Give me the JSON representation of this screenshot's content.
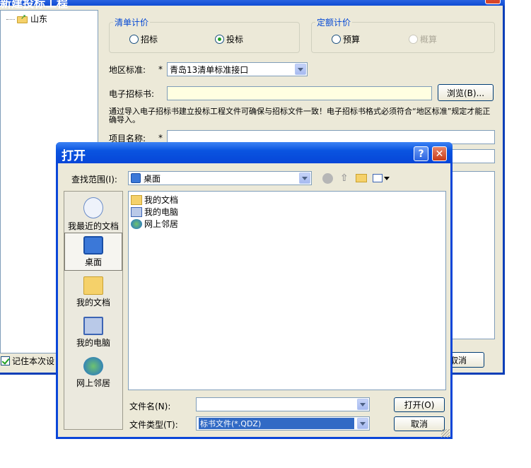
{
  "parent": {
    "title": "新建投标工程",
    "tree_item": "山东",
    "group_list": {
      "title": "清单计价",
      "options": [
        "招标",
        "投标"
      ],
      "selected": "投标"
    },
    "group_quota": {
      "title": "定额计价",
      "options": [
        "预算",
        "概算"
      ],
      "selected": ""
    },
    "region_label": "地区标准:",
    "required_mark": "*",
    "region_value": "青岛13清单标准接口",
    "etender_label": "电子招标书:",
    "browse_label": "浏览(B)...",
    "note": "通过导入电子招标书建立投标工程文件可确保与招标文件一致！电子招标书格式必须符合“地区标准”规定才能正确导入。",
    "project_label": "项目名称:",
    "remember_label": "记住本次设",
    "cancel_partial": "取消"
  },
  "open_dialog": {
    "title": "打开",
    "help_label": "?",
    "close_label": "✕",
    "lookin_label": "查找范围(I):",
    "lookin_value": "桌面",
    "places": [
      {
        "label": "我最近的文档",
        "icon": "recent-documents-icon"
      },
      {
        "label": "桌面",
        "icon": "desktop-icon"
      },
      {
        "label": "我的文档",
        "icon": "my-documents-icon"
      },
      {
        "label": "我的电脑",
        "icon": "my-computer-icon"
      },
      {
        "label": "网上邻居",
        "icon": "network-places-icon"
      }
    ],
    "files": [
      {
        "name": "我的文档",
        "icon": "my-documents-icon"
      },
      {
        "name": "我的电脑",
        "icon": "my-computer-icon"
      },
      {
        "name": "网上邻居",
        "icon": "network-places-icon"
      }
    ],
    "filename_label": "文件名(N):",
    "filename_value": "",
    "filetype_label": "文件类型(T):",
    "filetype_value": "标书文件(*.QDZ)",
    "open_button": "打开(O)",
    "cancel_button": "取消"
  },
  "colors": {
    "title_blue": "#0a54e0",
    "dialog_bg": "#ece9d8",
    "selection": "#316ac5",
    "group_title": "#0046d5"
  }
}
